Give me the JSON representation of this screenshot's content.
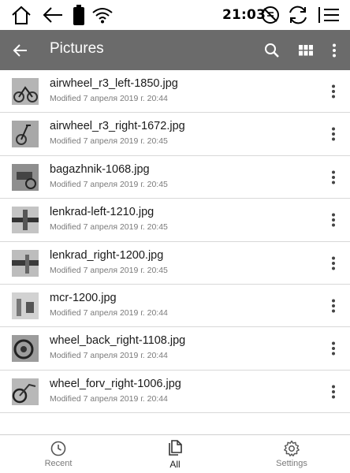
{
  "status_bar": {
    "time": "21:03",
    "icons": [
      "home-icon",
      "back-arrow-icon",
      "battery-icon",
      "wifi-icon",
      "sync-disabled-icon",
      "refresh-icon",
      "menu-icon"
    ]
  },
  "app_bar": {
    "title": "Pictures",
    "back_icon": "arrow-left-icon",
    "actions": [
      "search-icon",
      "grid-view-icon",
      "more-vert-icon"
    ]
  },
  "files": [
    {
      "name": "airwheel_r3_left-1850.jpg",
      "modified": "Modified 7 апреля 2019 г. 20:44"
    },
    {
      "name": "airwheel_r3_right-1672.jpg",
      "modified": "Modified 7 апреля 2019 г. 20:45"
    },
    {
      "name": "bagazhnik-1068.jpg",
      "modified": "Modified 7 апреля 2019 г. 20:45"
    },
    {
      "name": "lenkrad-left-1210.jpg",
      "modified": "Modified 7 апреля 2019 г. 20:45"
    },
    {
      "name": "lenkrad_right-1200.jpg",
      "modified": "Modified 7 апреля 2019 г. 20:45"
    },
    {
      "name": "mcr-1200.jpg",
      "modified": "Modified 7 апреля 2019 г. 20:44"
    },
    {
      "name": "wheel_back_right-1108.jpg",
      "modified": "Modified 7 апреля 2019 г. 20:44"
    },
    {
      "name": "wheel_forv_right-1006.jpg",
      "modified": "Modified 7 апреля 2019 г. 20:44"
    }
  ],
  "bottom_nav": {
    "tabs": [
      {
        "label": "Recent",
        "icon": "clock-icon"
      },
      {
        "label": "All",
        "icon": "files-icon",
        "selected": true
      },
      {
        "label": "Settings",
        "icon": "gear-icon"
      }
    ]
  },
  "colors": {
    "app_bar": "#6b6b6b",
    "divider": "#d8d8d8",
    "secondary_text": "#7a7a7a"
  }
}
